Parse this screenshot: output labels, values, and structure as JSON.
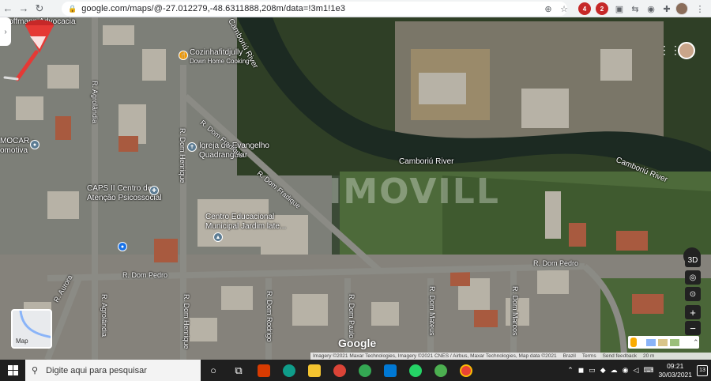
{
  "browser": {
    "url": "google.com/maps/@-27.012279,-48.6311888,208m/data=!3m1!1e3",
    "badge_1": "4",
    "badge_2": "2"
  },
  "map": {
    "labels": {
      "hoffmann": "Hoffmann Advocacia",
      "cozinha_line1": "Cozinhafitdjully",
      "cozinha_line2": "Down Home Cooking",
      "igreja_line1": "Igreja do Evangelho",
      "igreja_line2": "Quadrangular",
      "caps_line1": "CAPS II Centro de",
      "caps_line2": "Atenção Psicossocial",
      "centro_line1": "Centro Educacional",
      "centro_line2": "Municipal Jardim late...",
      "mocar_line1": "MOCAR -",
      "mocar_line2": "omotiva",
      "camboriu_river_1": "Camboriú River",
      "camboriu_river_2": "Camboriú River",
      "camboriu_river_3": "Camboriú River",
      "r_agrolandia_1": "R. Agrolândia",
      "r_agrolandia_2": "R. Agrolândia",
      "r_dom_henrique_1": "R. Dom Henrique",
      "r_dom_henrique_2": "R. Dom Henrique",
      "r_dom_fradique_1": "R. Dom Fradique",
      "r_dom_fradique_2": "R. Dom Fradique",
      "r_dom_pedro_1": "R. Dom Pedro",
      "r_dom_pedro_2": "R. Dom Pedro",
      "r_aurora": "R. Aurora",
      "r_dom_rodrigo": "R. Dom Rodrigo",
      "r_dom_paulo": "R. Dom Paulo",
      "r_dom_mateus": "R. Dom Mateus",
      "r_dom_marcos": "R. Dom Marcos"
    },
    "watermark": "IMOVILL",
    "controls": {
      "btn_3d": "3D",
      "zoom_in": "+",
      "zoom_out": "−"
    },
    "thumbnail_label": "Map",
    "google_logo": "Google",
    "footer": {
      "imagery": "Imagery ©2021 Maxar Technologies, Imagery ©2021 CNES / Airbus, Maxar Technologies, Map data ©2021",
      "region": "Brazil",
      "terms": "Terms",
      "feedback": "Send feedback",
      "scale": "20 m"
    }
  },
  "taskbar": {
    "search_placeholder": "Digite aqui para pesquisar",
    "time": "09:21",
    "date": "30/03/2021",
    "notifications": "13"
  },
  "colors": {
    "pin_red": "#e53935",
    "river": "#1c2a22",
    "road": "#8b8b85"
  }
}
